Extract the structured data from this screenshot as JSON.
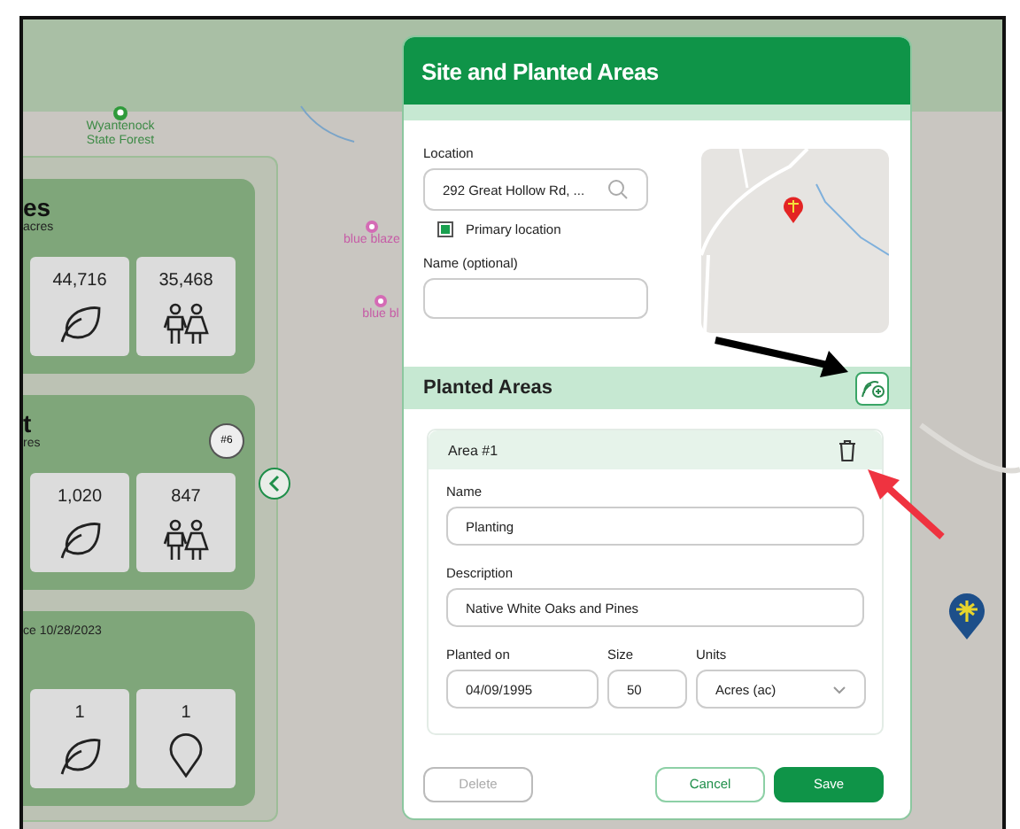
{
  "map": {
    "pois": [
      {
        "label": "Wyantenock State Forest",
        "kind": "park"
      },
      {
        "label": "blue blaze",
        "kind": "trail"
      },
      {
        "label": "blue bl",
        "kind": "trail"
      }
    ]
  },
  "stats_panel": {
    "cards": [
      {
        "title": "es",
        "subtitle": "acres",
        "tiles": [
          {
            "value": "44,716",
            "kind": "leaf"
          },
          {
            "value": "35,468",
            "kind": "people"
          }
        ]
      },
      {
        "title": "t",
        "subtitle": "res",
        "badge": "#6",
        "tiles": [
          {
            "value": "1,020",
            "kind": "leaf"
          },
          {
            "value": "847",
            "kind": "people"
          }
        ]
      },
      {
        "subtitle": "ce 10/28/2023",
        "tiles": [
          {
            "value": "1",
            "kind": "leaf"
          },
          {
            "value": "1",
            "kind": "pin"
          }
        ]
      }
    ]
  },
  "modal": {
    "title": "Site and Planted Areas",
    "site": {
      "location_label": "Location",
      "location_value": "292 Great Hollow Rd, ...",
      "primary_location": {
        "label": "Primary location",
        "checked": true
      },
      "name_label": "Name (optional)"
    },
    "planted_areas": {
      "title": "Planted Areas",
      "areas": [
        {
          "title": "Area #1",
          "name_label": "Name",
          "name": "Planting",
          "description_label": "Description",
          "description": "Native White Oaks and Pines",
          "planted_on_label": "Planted on",
          "planted_on": "04/09/1995",
          "size_label": "Size",
          "size": "50",
          "units_label": "Units",
          "units": "Acres (ac)"
        }
      ]
    },
    "buttons": [
      {
        "label": "Delete",
        "kind": "outline",
        "disabled": true
      },
      {
        "label": "Cancel",
        "kind": "outline",
        "disabled": false
      },
      {
        "label": "Save",
        "kind": "primary",
        "disabled": false
      }
    ]
  }
}
